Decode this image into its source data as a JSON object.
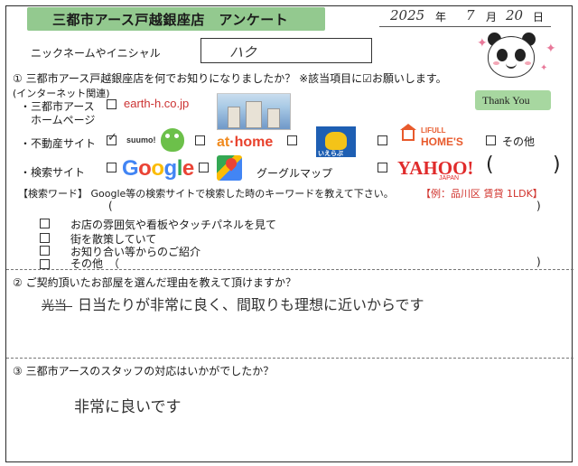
{
  "header": {
    "title": "三都市アース戸越銀座店　アンケート",
    "date": {
      "year": "2025",
      "year_kanji": "年",
      "month": "7",
      "month_kanji": "月",
      "day": "20",
      "day_kanji": "日"
    }
  },
  "nickname": {
    "label": "ニックネームやイニシャル",
    "value": "ハク"
  },
  "q1": {
    "text": "① 三都市アース戸越銀座店を何でお知りになりましたか？ ※該当項目に☑お願いします。",
    "internet_label": "(インターネット関連)",
    "homepage_label_1": "・三都市アース",
    "homepage_label_2": "ホームページ",
    "homepage_url": "earth-h.co.jp",
    "realestate_label": "・不動産サイト",
    "suumo": "suumo!",
    "athome_a": "at",
    "athome_b": "home",
    "iezoo": "いえらぶ",
    "lifull_a": "LIFULL",
    "lifull_b": "HOME'S",
    "other_label": "その他",
    "search_label": "・検索サイト",
    "google_letters": [
      "G",
      "o",
      "o",
      "g",
      "l",
      "e"
    ],
    "maps_label": "グーグルマップ",
    "yahoo": "YAHOO!",
    "yahoo_jp": "JAPAN",
    "paren_open": "(",
    "paren_close": ")",
    "keyword_label": "【検索ワード】 Google等の検索サイトで検索した時のキーワードを教えて下さい。",
    "keyword_example": "【例：品川区 賃貸 1LDK】",
    "options": [
      "お店の雰囲気や看板やタッチパネルを見て",
      "街を散策していて",
      "お知り合い等からのご紹介",
      "その他　（"
    ]
  },
  "q2": {
    "text": "② ご契約頂いたお部屋を選んだ理由を教えて頂けますか？",
    "answer": "日当たりが非常に良く、間取りも理想に近いからです",
    "struck": "光当"
  },
  "q3": {
    "text": "③ 三都市アースのスタッフの対応はいかがでしたか？",
    "answer": "非常に良いです"
  },
  "mascot": {
    "thank_you": "Thank You"
  },
  "checked": {
    "realestate": true
  }
}
